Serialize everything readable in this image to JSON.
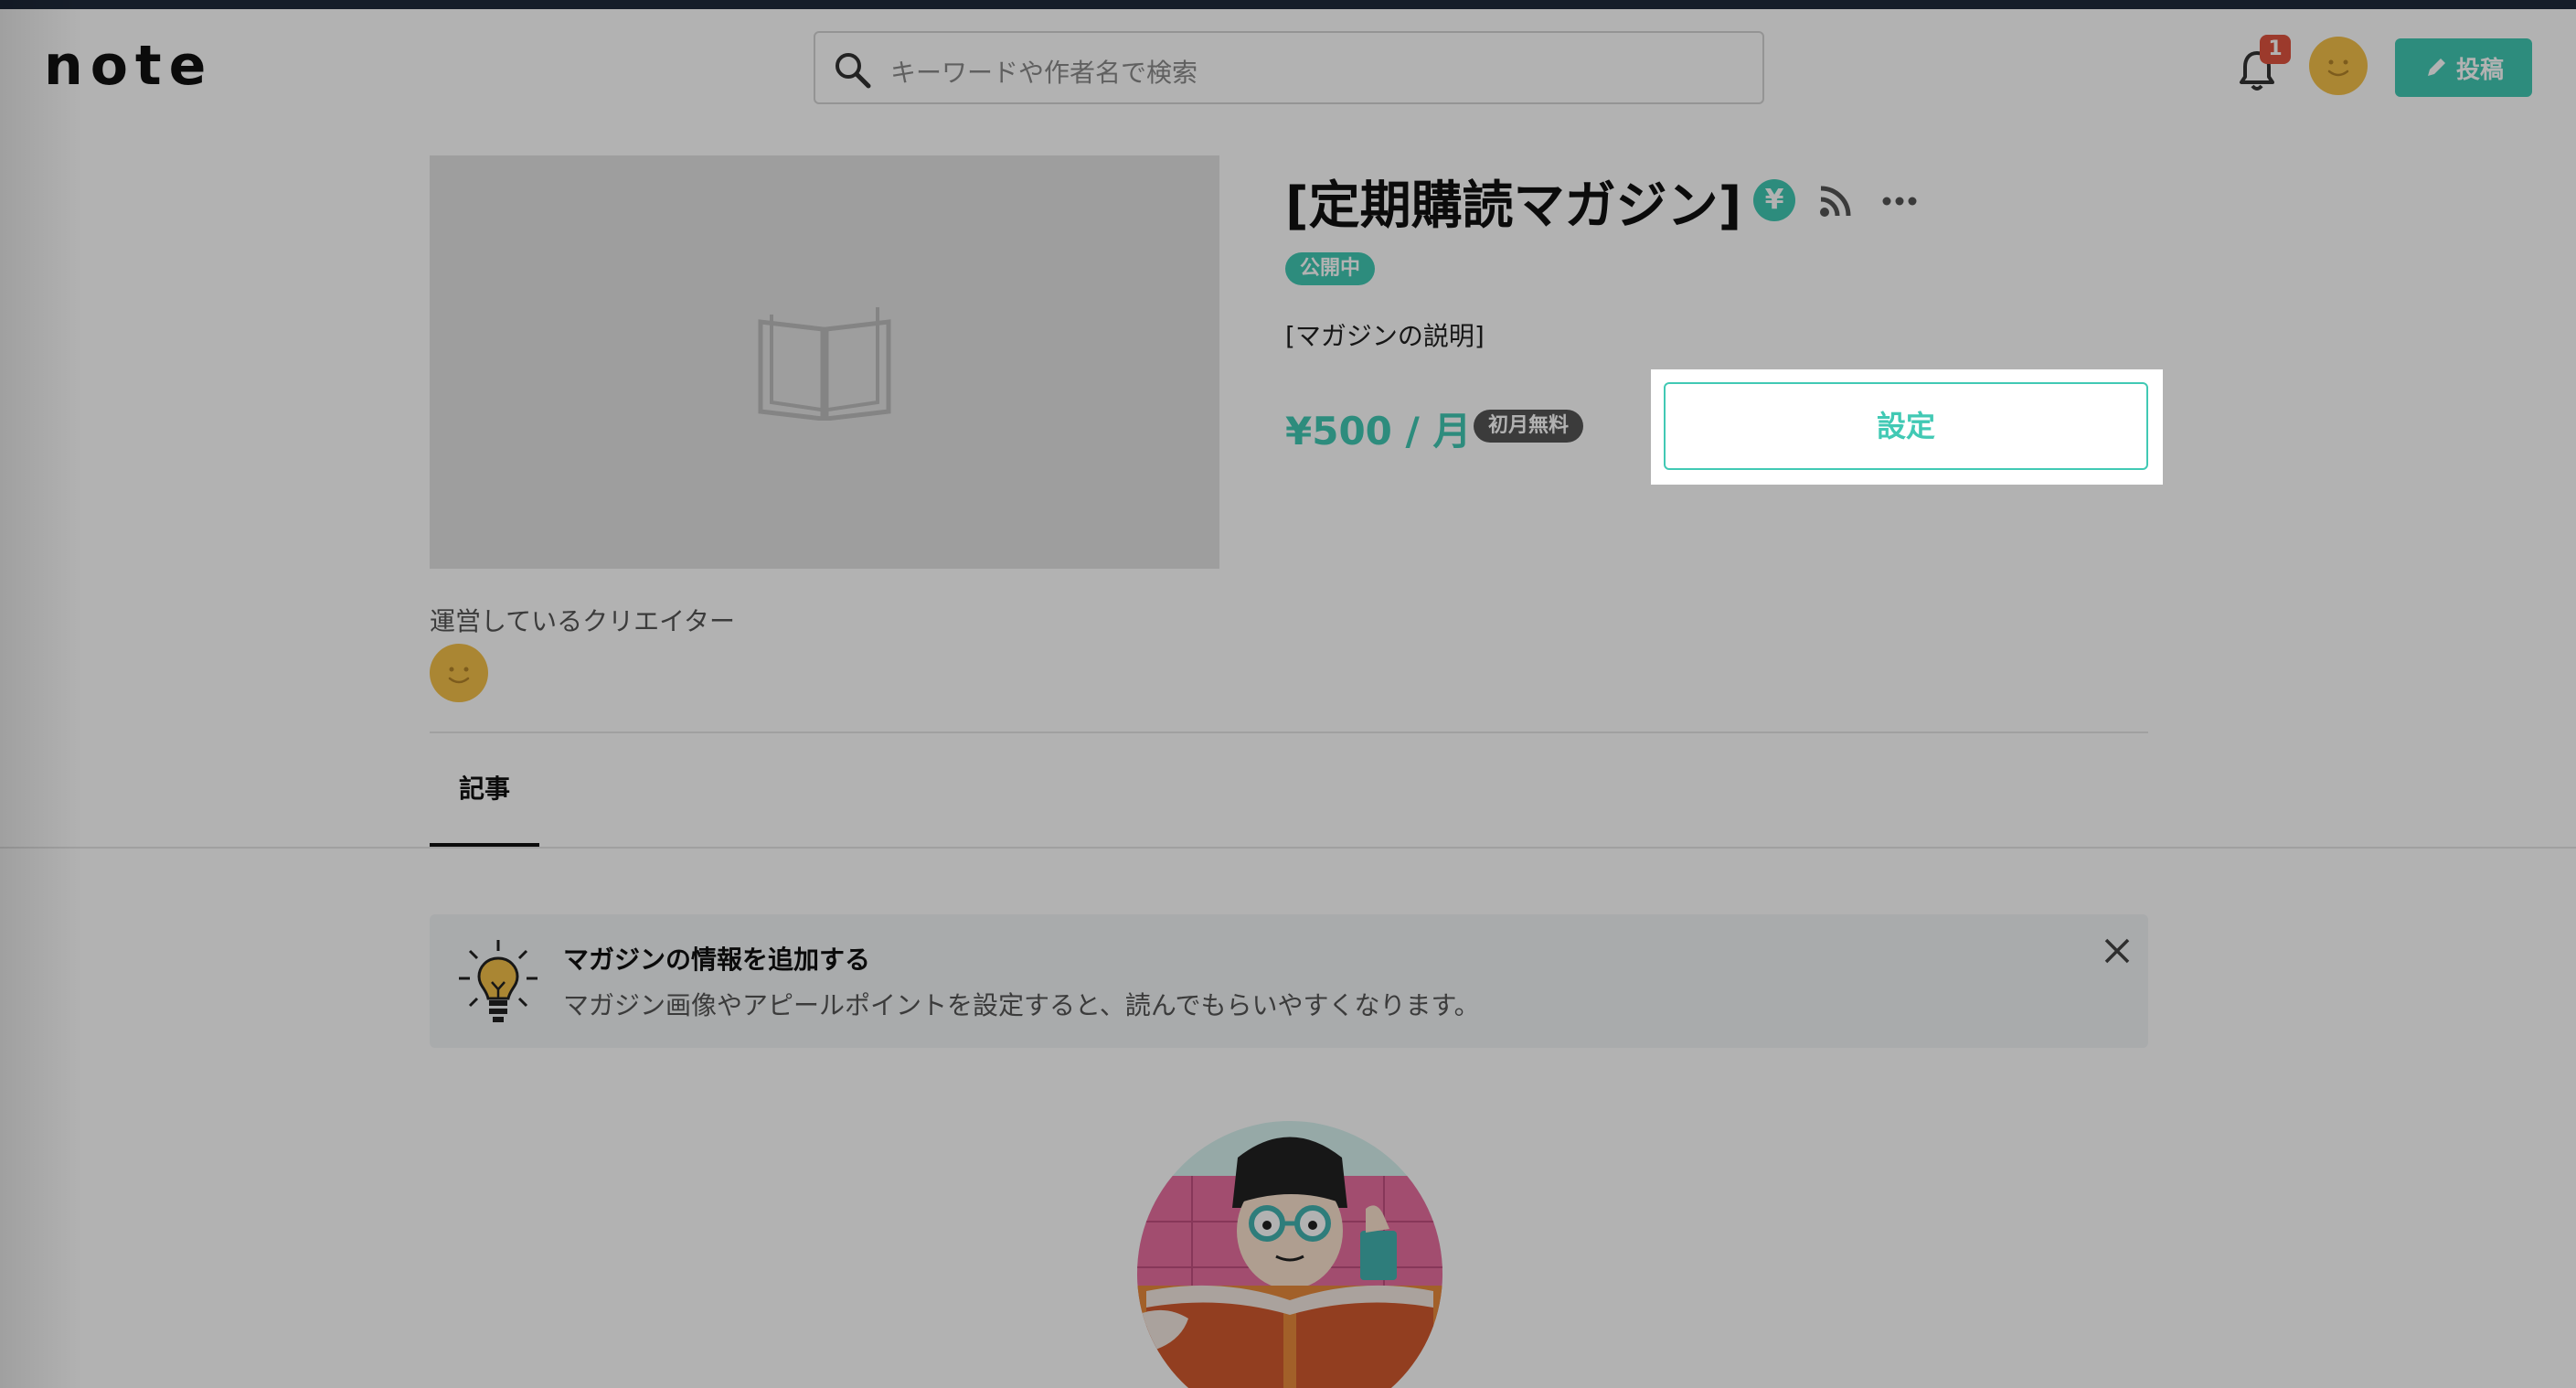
{
  "header": {
    "logo": "note",
    "search_placeholder": "キーワードや作者名で検索",
    "notification_count": "1",
    "post_label": "投稿"
  },
  "magazine": {
    "title": "[定期購読マガジン]",
    "status": "公開中",
    "description": "[マガジンの説明]",
    "price": "¥500 / 月",
    "trial_badge": "初月無料",
    "settings_label": "設定",
    "yen_symbol": "¥"
  },
  "creator": {
    "label": "運営しているクリエイター"
  },
  "tabs": [
    {
      "label": "記事",
      "active": true
    }
  ],
  "info_banner": {
    "title": "マガジンの情報を追加する",
    "text": "マガジン画像やアピールポイントを設定すると、読んでもらいやすくなります。"
  },
  "colors": {
    "accent": "#41c9b4",
    "avatar": "#f4c04a",
    "badge": "#e0543f"
  }
}
